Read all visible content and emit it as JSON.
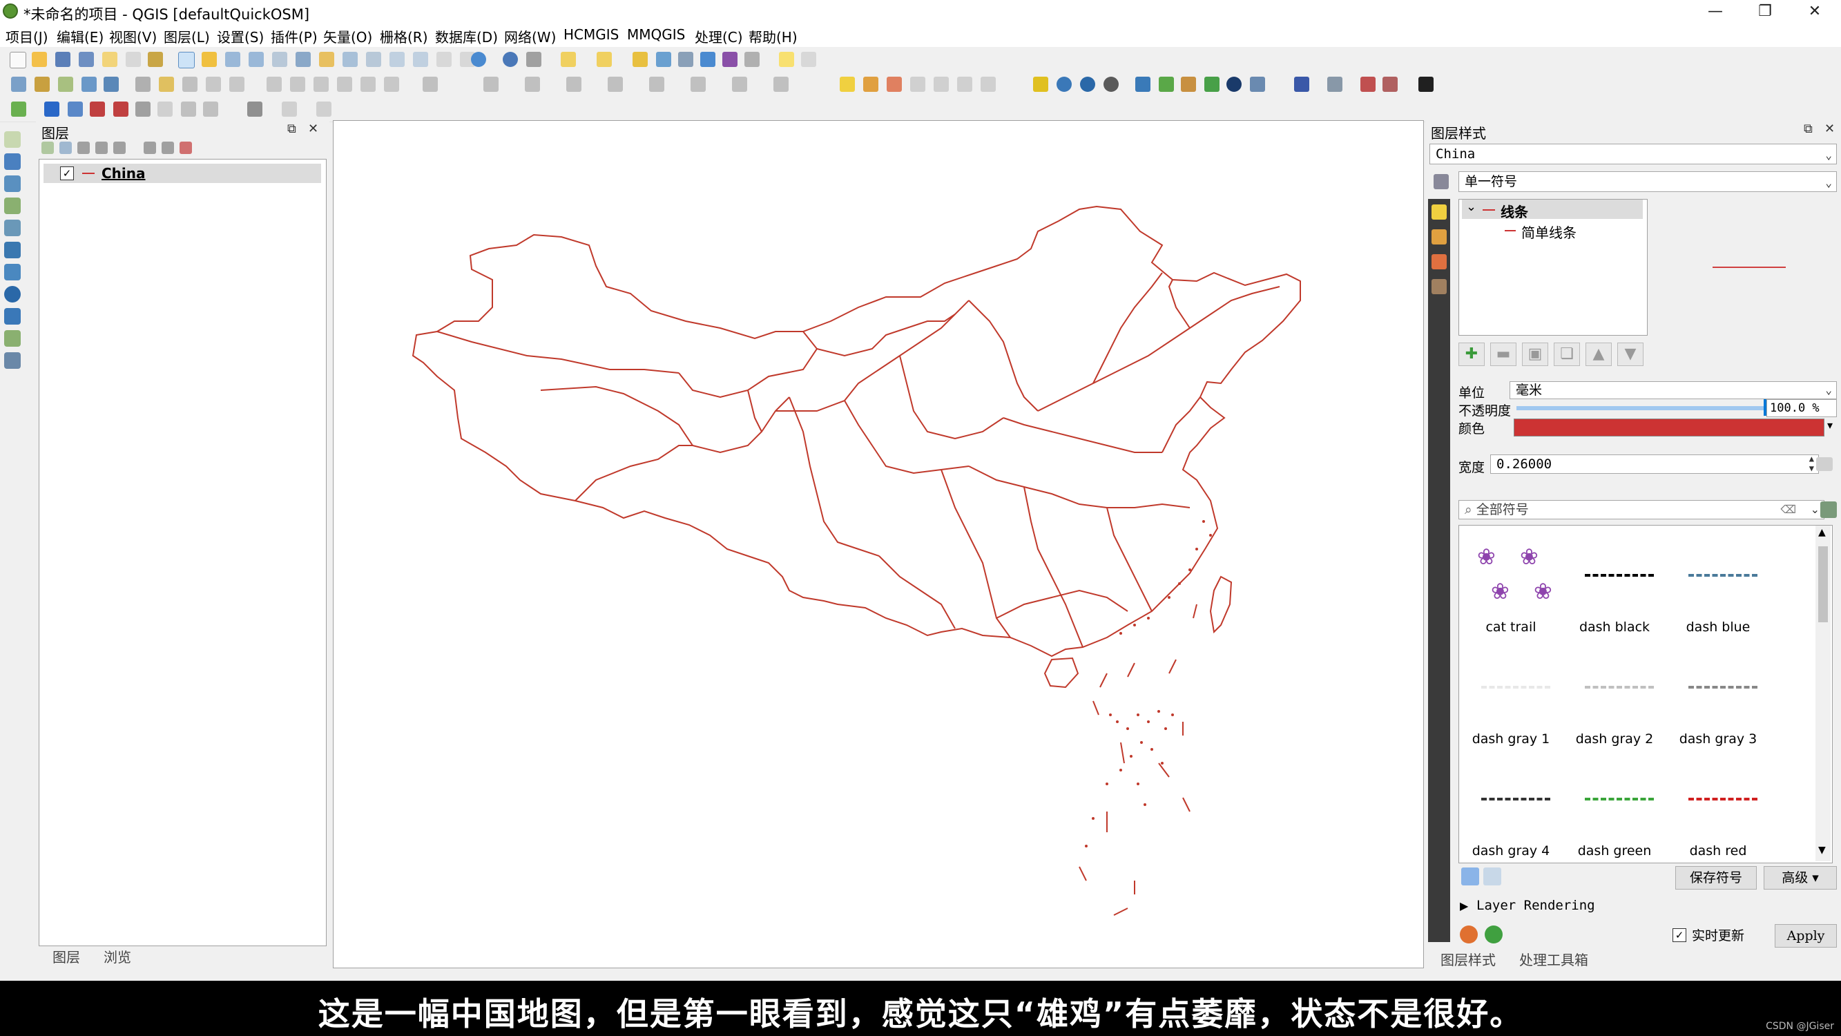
{
  "window": {
    "title": "*未命名的项目 - QGIS [defaultQuickOSM]",
    "minimize": "—",
    "restore": "❐",
    "close": "✕"
  },
  "menu": [
    "项目(J)",
    "编辑(E)",
    "视图(V)",
    "图层(L)",
    "设置(S)",
    "插件(P)",
    "矢量(O)",
    "栅格(R)",
    "数据库(D)",
    "网络(W)",
    "HCMGIS",
    "MMQGIS",
    "处理(C)",
    "帮助(H)"
  ],
  "layers_panel": {
    "title": "图层",
    "layer_name": "China",
    "tabs": [
      "图层",
      "浏览"
    ]
  },
  "style_panel": {
    "title": "图层样式",
    "layer_select": "China",
    "renderer": "单一符号",
    "tree_root": "线条",
    "tree_child": "简单线条",
    "unit_label": "单位",
    "unit_value": "毫米",
    "opacity_label": "不透明度",
    "opacity_value": "100.0 %",
    "opacity_fraction": 1.0,
    "color_label": "颜色",
    "line_color": "#cc3333",
    "width_label": "宽度",
    "width_value": "0.26000",
    "search_placeholder": "全部符号",
    "symbols": [
      {
        "name": "cat trail",
        "color": "#8e44ad"
      },
      {
        "name": "dash  black",
        "color": "#000000"
      },
      {
        "name": "dash blue",
        "color": "#4a7a9a"
      },
      {
        "name": "dash gray 1",
        "color": "#e8e8e8"
      },
      {
        "name": "dash gray 2",
        "color": "#c0c0c0"
      },
      {
        "name": "dash gray 3",
        "color": "#888888"
      },
      {
        "name": "dash gray 4",
        "color": "#333333"
      },
      {
        "name": "dash green",
        "color": "#3aa53a"
      },
      {
        "name": "dash red",
        "color": "#d02020"
      }
    ],
    "save_symbol": "保存符号",
    "advanced": "高级",
    "layer_rendering": "Layer Rendering",
    "live_update": "实时更新",
    "apply": "Apply",
    "bottom_tabs": [
      "图层样式",
      "处理工具箱"
    ]
  },
  "subtitle": "这是一幅中国地图，但是第一眼看到，感觉这只“雄鸡”有点萎靡，状态不是很好。",
  "watermark": "CSDN @JGiser"
}
